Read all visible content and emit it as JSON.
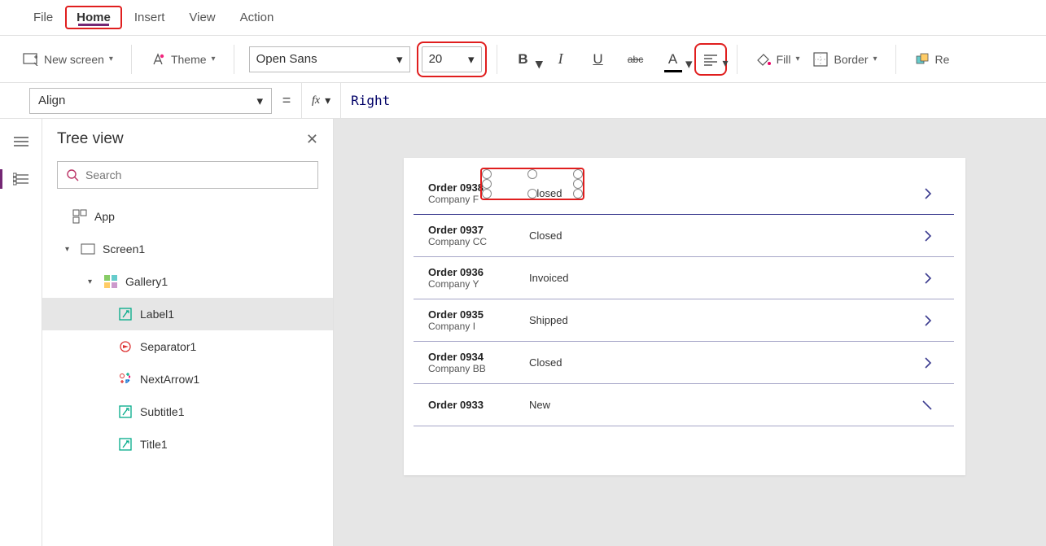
{
  "menu": {
    "items": [
      "File",
      "Home",
      "Insert",
      "View",
      "Action"
    ],
    "active_index": 1,
    "highlighted_index": 1
  },
  "ribbon": {
    "new_screen": "New screen",
    "theme": "Theme",
    "font_family": "Open Sans",
    "font_size": "20",
    "bold": "B",
    "fill_label": "Fill",
    "border_label": "Border",
    "reorder_label": "Re"
  },
  "formula": {
    "property": "Align",
    "fx": "fx",
    "value": "Right"
  },
  "tree": {
    "title": "Tree view",
    "search_placeholder": "Search",
    "nodes": {
      "app": "App",
      "screen": "Screen1",
      "gallery": "Gallery1",
      "children": [
        "Label1",
        "Separator1",
        "NextArrow1",
        "Subtitle1",
        "Title1"
      ],
      "selected": "Label1"
    }
  },
  "canvas": {
    "items": [
      {
        "title": "Order 0938",
        "subtitle": "Company F",
        "status": "Closed"
      },
      {
        "title": "Order 0937",
        "subtitle": "Company CC",
        "status": "Closed"
      },
      {
        "title": "Order 0936",
        "subtitle": "Company Y",
        "status": "Invoiced"
      },
      {
        "title": "Order 0935",
        "subtitle": "Company I",
        "status": "Shipped"
      },
      {
        "title": "Order 0934",
        "subtitle": "Company BB",
        "status": "Closed"
      },
      {
        "title": "Order 0933",
        "subtitle": "",
        "status": "New"
      }
    ]
  }
}
